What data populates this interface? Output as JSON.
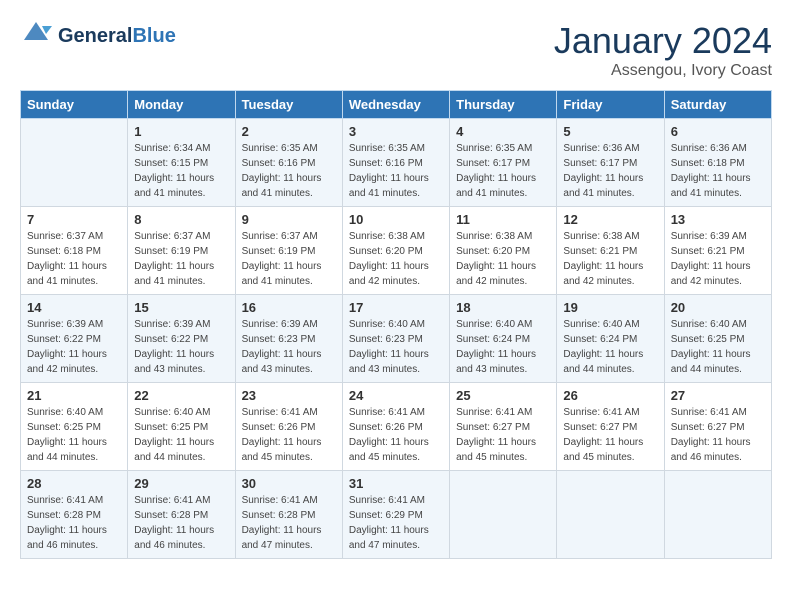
{
  "header": {
    "logo_general": "General",
    "logo_blue": "Blue",
    "month_year": "January 2024",
    "location": "Assengou, Ivory Coast"
  },
  "weekdays": [
    "Sunday",
    "Monday",
    "Tuesday",
    "Wednesday",
    "Thursday",
    "Friday",
    "Saturday"
  ],
  "weeks": [
    [
      {
        "day": "",
        "sunrise": "",
        "sunset": "",
        "daylight": ""
      },
      {
        "day": "1",
        "sunrise": "Sunrise: 6:34 AM",
        "sunset": "Sunset: 6:15 PM",
        "daylight": "Daylight: 11 hours and 41 minutes."
      },
      {
        "day": "2",
        "sunrise": "Sunrise: 6:35 AM",
        "sunset": "Sunset: 6:16 PM",
        "daylight": "Daylight: 11 hours and 41 minutes."
      },
      {
        "day": "3",
        "sunrise": "Sunrise: 6:35 AM",
        "sunset": "Sunset: 6:16 PM",
        "daylight": "Daylight: 11 hours and 41 minutes."
      },
      {
        "day": "4",
        "sunrise": "Sunrise: 6:35 AM",
        "sunset": "Sunset: 6:17 PM",
        "daylight": "Daylight: 11 hours and 41 minutes."
      },
      {
        "day": "5",
        "sunrise": "Sunrise: 6:36 AM",
        "sunset": "Sunset: 6:17 PM",
        "daylight": "Daylight: 11 hours and 41 minutes."
      },
      {
        "day": "6",
        "sunrise": "Sunrise: 6:36 AM",
        "sunset": "Sunset: 6:18 PM",
        "daylight": "Daylight: 11 hours and 41 minutes."
      }
    ],
    [
      {
        "day": "7",
        "sunrise": "Sunrise: 6:37 AM",
        "sunset": "Sunset: 6:18 PM",
        "daylight": "Daylight: 11 hours and 41 minutes."
      },
      {
        "day": "8",
        "sunrise": "Sunrise: 6:37 AM",
        "sunset": "Sunset: 6:19 PM",
        "daylight": "Daylight: 11 hours and 41 minutes."
      },
      {
        "day": "9",
        "sunrise": "Sunrise: 6:37 AM",
        "sunset": "Sunset: 6:19 PM",
        "daylight": "Daylight: 11 hours and 41 minutes."
      },
      {
        "day": "10",
        "sunrise": "Sunrise: 6:38 AM",
        "sunset": "Sunset: 6:20 PM",
        "daylight": "Daylight: 11 hours and 42 minutes."
      },
      {
        "day": "11",
        "sunrise": "Sunrise: 6:38 AM",
        "sunset": "Sunset: 6:20 PM",
        "daylight": "Daylight: 11 hours and 42 minutes."
      },
      {
        "day": "12",
        "sunrise": "Sunrise: 6:38 AM",
        "sunset": "Sunset: 6:21 PM",
        "daylight": "Daylight: 11 hours and 42 minutes."
      },
      {
        "day": "13",
        "sunrise": "Sunrise: 6:39 AM",
        "sunset": "Sunset: 6:21 PM",
        "daylight": "Daylight: 11 hours and 42 minutes."
      }
    ],
    [
      {
        "day": "14",
        "sunrise": "Sunrise: 6:39 AM",
        "sunset": "Sunset: 6:22 PM",
        "daylight": "Daylight: 11 hours and 42 minutes."
      },
      {
        "day": "15",
        "sunrise": "Sunrise: 6:39 AM",
        "sunset": "Sunset: 6:22 PM",
        "daylight": "Daylight: 11 hours and 43 minutes."
      },
      {
        "day": "16",
        "sunrise": "Sunrise: 6:39 AM",
        "sunset": "Sunset: 6:23 PM",
        "daylight": "Daylight: 11 hours and 43 minutes."
      },
      {
        "day": "17",
        "sunrise": "Sunrise: 6:40 AM",
        "sunset": "Sunset: 6:23 PM",
        "daylight": "Daylight: 11 hours and 43 minutes."
      },
      {
        "day": "18",
        "sunrise": "Sunrise: 6:40 AM",
        "sunset": "Sunset: 6:24 PM",
        "daylight": "Daylight: 11 hours and 43 minutes."
      },
      {
        "day": "19",
        "sunrise": "Sunrise: 6:40 AM",
        "sunset": "Sunset: 6:24 PM",
        "daylight": "Daylight: 11 hours and 44 minutes."
      },
      {
        "day": "20",
        "sunrise": "Sunrise: 6:40 AM",
        "sunset": "Sunset: 6:25 PM",
        "daylight": "Daylight: 11 hours and 44 minutes."
      }
    ],
    [
      {
        "day": "21",
        "sunrise": "Sunrise: 6:40 AM",
        "sunset": "Sunset: 6:25 PM",
        "daylight": "Daylight: 11 hours and 44 minutes."
      },
      {
        "day": "22",
        "sunrise": "Sunrise: 6:40 AM",
        "sunset": "Sunset: 6:25 PM",
        "daylight": "Daylight: 11 hours and 44 minutes."
      },
      {
        "day": "23",
        "sunrise": "Sunrise: 6:41 AM",
        "sunset": "Sunset: 6:26 PM",
        "daylight": "Daylight: 11 hours and 45 minutes."
      },
      {
        "day": "24",
        "sunrise": "Sunrise: 6:41 AM",
        "sunset": "Sunset: 6:26 PM",
        "daylight": "Daylight: 11 hours and 45 minutes."
      },
      {
        "day": "25",
        "sunrise": "Sunrise: 6:41 AM",
        "sunset": "Sunset: 6:27 PM",
        "daylight": "Daylight: 11 hours and 45 minutes."
      },
      {
        "day": "26",
        "sunrise": "Sunrise: 6:41 AM",
        "sunset": "Sunset: 6:27 PM",
        "daylight": "Daylight: 11 hours and 45 minutes."
      },
      {
        "day": "27",
        "sunrise": "Sunrise: 6:41 AM",
        "sunset": "Sunset: 6:27 PM",
        "daylight": "Daylight: 11 hours and 46 minutes."
      }
    ],
    [
      {
        "day": "28",
        "sunrise": "Sunrise: 6:41 AM",
        "sunset": "Sunset: 6:28 PM",
        "daylight": "Daylight: 11 hours and 46 minutes."
      },
      {
        "day": "29",
        "sunrise": "Sunrise: 6:41 AM",
        "sunset": "Sunset: 6:28 PM",
        "daylight": "Daylight: 11 hours and 46 minutes."
      },
      {
        "day": "30",
        "sunrise": "Sunrise: 6:41 AM",
        "sunset": "Sunset: 6:28 PM",
        "daylight": "Daylight: 11 hours and 47 minutes."
      },
      {
        "day": "31",
        "sunrise": "Sunrise: 6:41 AM",
        "sunset": "Sunset: 6:29 PM",
        "daylight": "Daylight: 11 hours and 47 minutes."
      },
      {
        "day": "",
        "sunrise": "",
        "sunset": "",
        "daylight": ""
      },
      {
        "day": "",
        "sunrise": "",
        "sunset": "",
        "daylight": ""
      },
      {
        "day": "",
        "sunrise": "",
        "sunset": "",
        "daylight": ""
      }
    ]
  ]
}
